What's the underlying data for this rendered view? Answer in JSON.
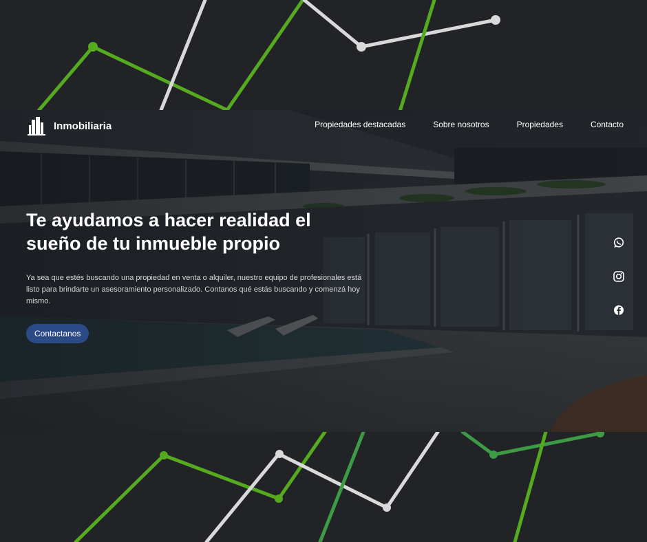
{
  "nav": {
    "brand": "Inmobiliaria",
    "links": [
      "Propiedades destacadas",
      "Sobre nosotros",
      "Propiedades",
      "Contacto"
    ]
  },
  "hero": {
    "headline": "Te ayudamos a hacer realidad el sueño de tu inmueble propio",
    "description": "Ya sea que estés buscando una propiedad en venta o alquiler, nuestro equipo de profesionales está listo para brindarte un asesoramiento personalizado. Contanos qué estás buscando y comenzá hoy mismo.",
    "cta_label": "Contactanos"
  },
  "social": {
    "icons": [
      "whatsapp-icon",
      "instagram-icon",
      "facebook-icon"
    ]
  },
  "colors": {
    "page_background": "#222326",
    "accent_green": "#55aa1f",
    "line_grey": "#d9d9d9",
    "button_blue": "#2b4a86"
  }
}
